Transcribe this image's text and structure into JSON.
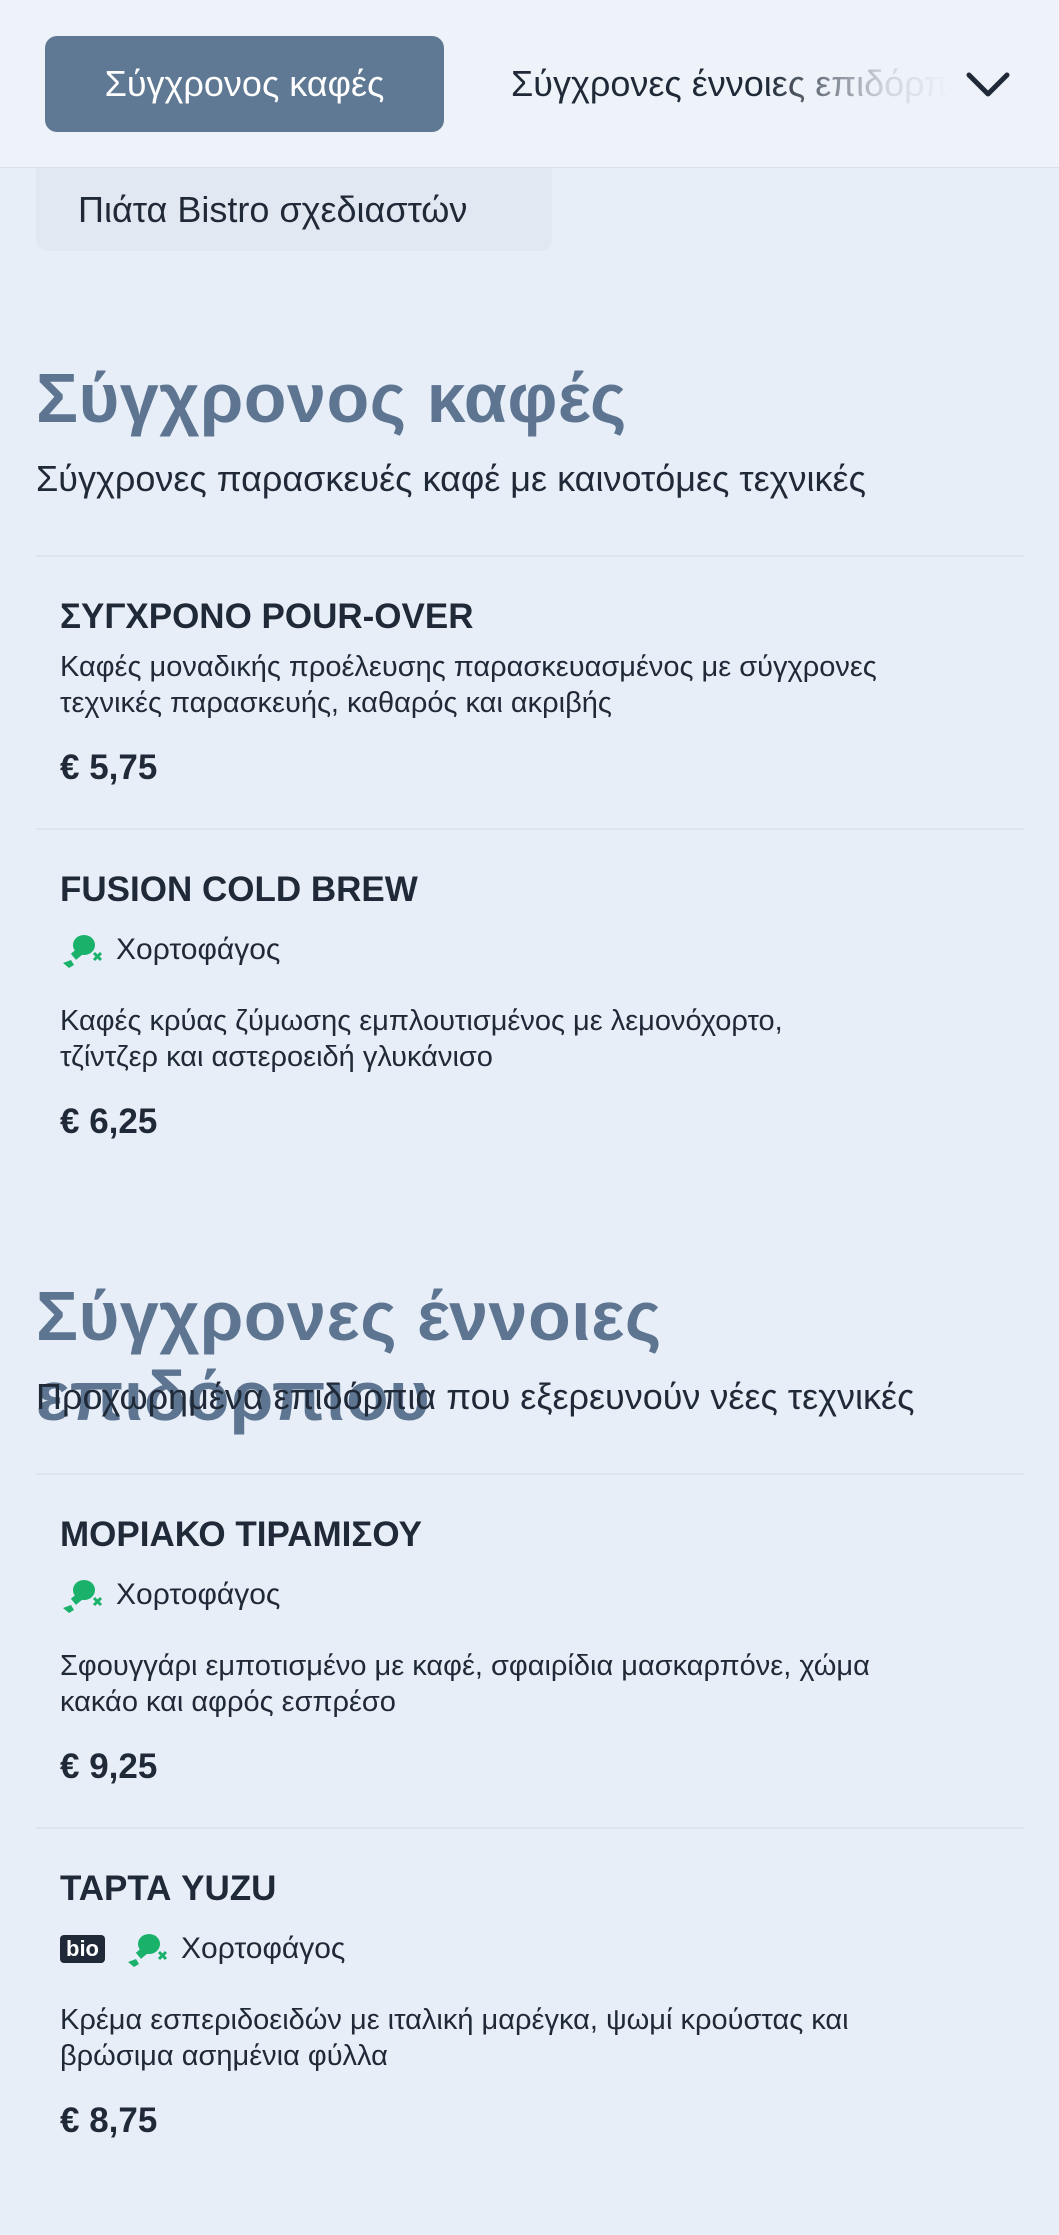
{
  "tabs": {
    "active": "Σύγχρονος καφές",
    "next": "Σύγχρονες έννοιες επιδόρπιου",
    "third": "Πιάτα Bistro σχεδιαστών"
  },
  "icons": {
    "chevron": "chevron-down-icon",
    "vegetarian": "vegetarian-drumstick-icon"
  },
  "colors": {
    "accent": "#5f7893",
    "heading": "#5d7591",
    "vegetarian": "#1ab26b",
    "background": "#e8eef8"
  },
  "sections": [
    {
      "title": "Σύγχρονος καφές",
      "subtitle": "Σύγχρονες παρασκευές καφέ με καινοτόμες τεχνικές",
      "items": [
        {
          "name": "ΣΥΓΧΡΟΝΟ POUR-OVER",
          "description_line1": "Καφές μοναδικής προέλευσης παρασκευασμένος με σύγχρονες",
          "description_line2": "τεχνικές παρασκευής, καθαρός και ακριβής",
          "price": "€ 5,75"
        },
        {
          "name": "FUSION COLD BREW",
          "tag": "Χορτοφάγος",
          "description_line1": "Καφές κρύας ζύμωσης εμπλουτισμένος με λεμονόχορτο,",
          "description_line2": "τζίντζερ και αστεροειδή γλυκάνισο",
          "price": "€ 6,25"
        }
      ]
    },
    {
      "title": "Σύγχρονες έννοιες επιδόρπιου",
      "subtitle": "Προχωρημένα επιδόρπια που εξερευνούν νέες τεχνικές",
      "items": [
        {
          "name": "ΜΟΡΙΑΚΟ ΤΙΡΑΜΙΣΟΥ",
          "tag": "Χορτοφάγος",
          "description_line1": "Σφουγγάρι εμποτισμένο με καφέ, σφαιρίδια μασκαρπόνε, χώμα",
          "description_line2": "κακάο και αφρός εσπρέσο",
          "price": "€ 9,25"
        },
        {
          "name": "ΤΑΡΤΑ YUZU",
          "badge": "bio",
          "tag": "Χορτοφάγος",
          "description_line1": "Κρέμα εσπεριδοειδών με ιταλική μαρέγκα, ψωμί κρούστας και",
          "description_line2": "βρώσιμα ασημένια φύλλα",
          "price": "€ 8,75"
        }
      ]
    }
  ]
}
